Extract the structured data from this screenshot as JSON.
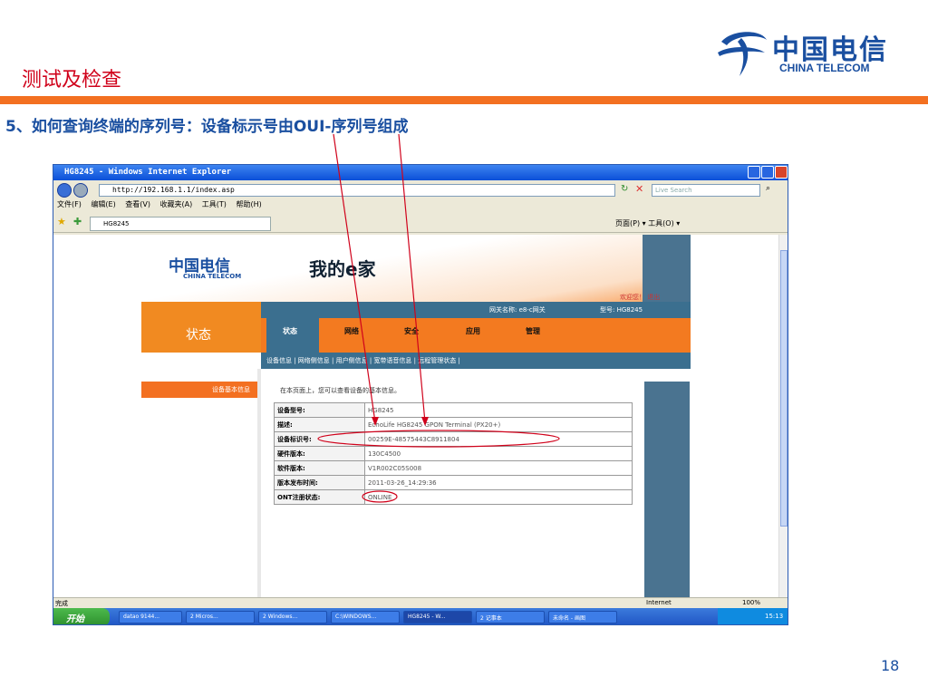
{
  "slide": {
    "title": "测试及检查",
    "subtitle": "5、如何查询终端的序列号：设备标示号由OUI-序列号组成",
    "page_number": "18",
    "logo_cn": "中国电信",
    "logo_en": "CHINA TELECOM"
  },
  "window": {
    "title": "HG8245 - Windows Internet Explorer",
    "address": "http://192.168.1.1/index.asp",
    "search_placeholder": "Live Search",
    "menu": [
      "文件(F)",
      "编辑(E)",
      "查看(V)",
      "收藏夹(A)",
      "工具(T)",
      "帮助(H)"
    ],
    "tab_label": "HG8245",
    "toolbar_right": "页面(P) ▾  工具(O) ▾"
  },
  "site": {
    "logo_cn": "中国电信",
    "logo_en": "CHINA TELECOM",
    "brand": "我的e家",
    "welcome": "欢迎您！   退出",
    "gateway_name": "网关名称: e8-c网关",
    "model_label": "型号: HG8245",
    "section_title": "状态",
    "nav": [
      "状态",
      "网络",
      "安全",
      "应用",
      "管理"
    ],
    "subnav": "设备信息 | 网络侧信息 | 用户侧信息 | 宽带语音信息 | 远程管理状态 |",
    "left_menu_item": "设备基本信息",
    "intro": "在本页面上，您可以查看设备的基本信息。",
    "device_info": [
      {
        "label": "设备型号:",
        "value": "HG8245"
      },
      {
        "label": "描述:",
        "value": "EchoLife HG8245 GPON Terminal (PX20+)"
      },
      {
        "label": "设备标识号:",
        "value": "00259E-48575443C8911804"
      },
      {
        "label": "硬件版本:",
        "value": "130C4500"
      },
      {
        "label": "软件版本:",
        "value": "V1R002C05S008"
      },
      {
        "label": "版本发布时间:",
        "value": "2011-03-26_14:29:36"
      },
      {
        "label": "ONT注册状态:",
        "value": "ONLINE"
      }
    ]
  },
  "statusbar": {
    "left": "完成",
    "zone": "Internet",
    "zoom": "100%"
  },
  "taskbar": {
    "start": "开始",
    "tasks": [
      "datao 9144...",
      "2 Micros...",
      "2 Windows...",
      "C:\\WINDOWS...",
      "HG8245 - W...",
      "2 记事本",
      "未命名 - 画图"
    ],
    "clock": "15:13"
  },
  "colors": {
    "accent_orange": "#f37021",
    "telecom_blue": "#1a4fa0",
    "annotation_red": "#d0021b"
  }
}
